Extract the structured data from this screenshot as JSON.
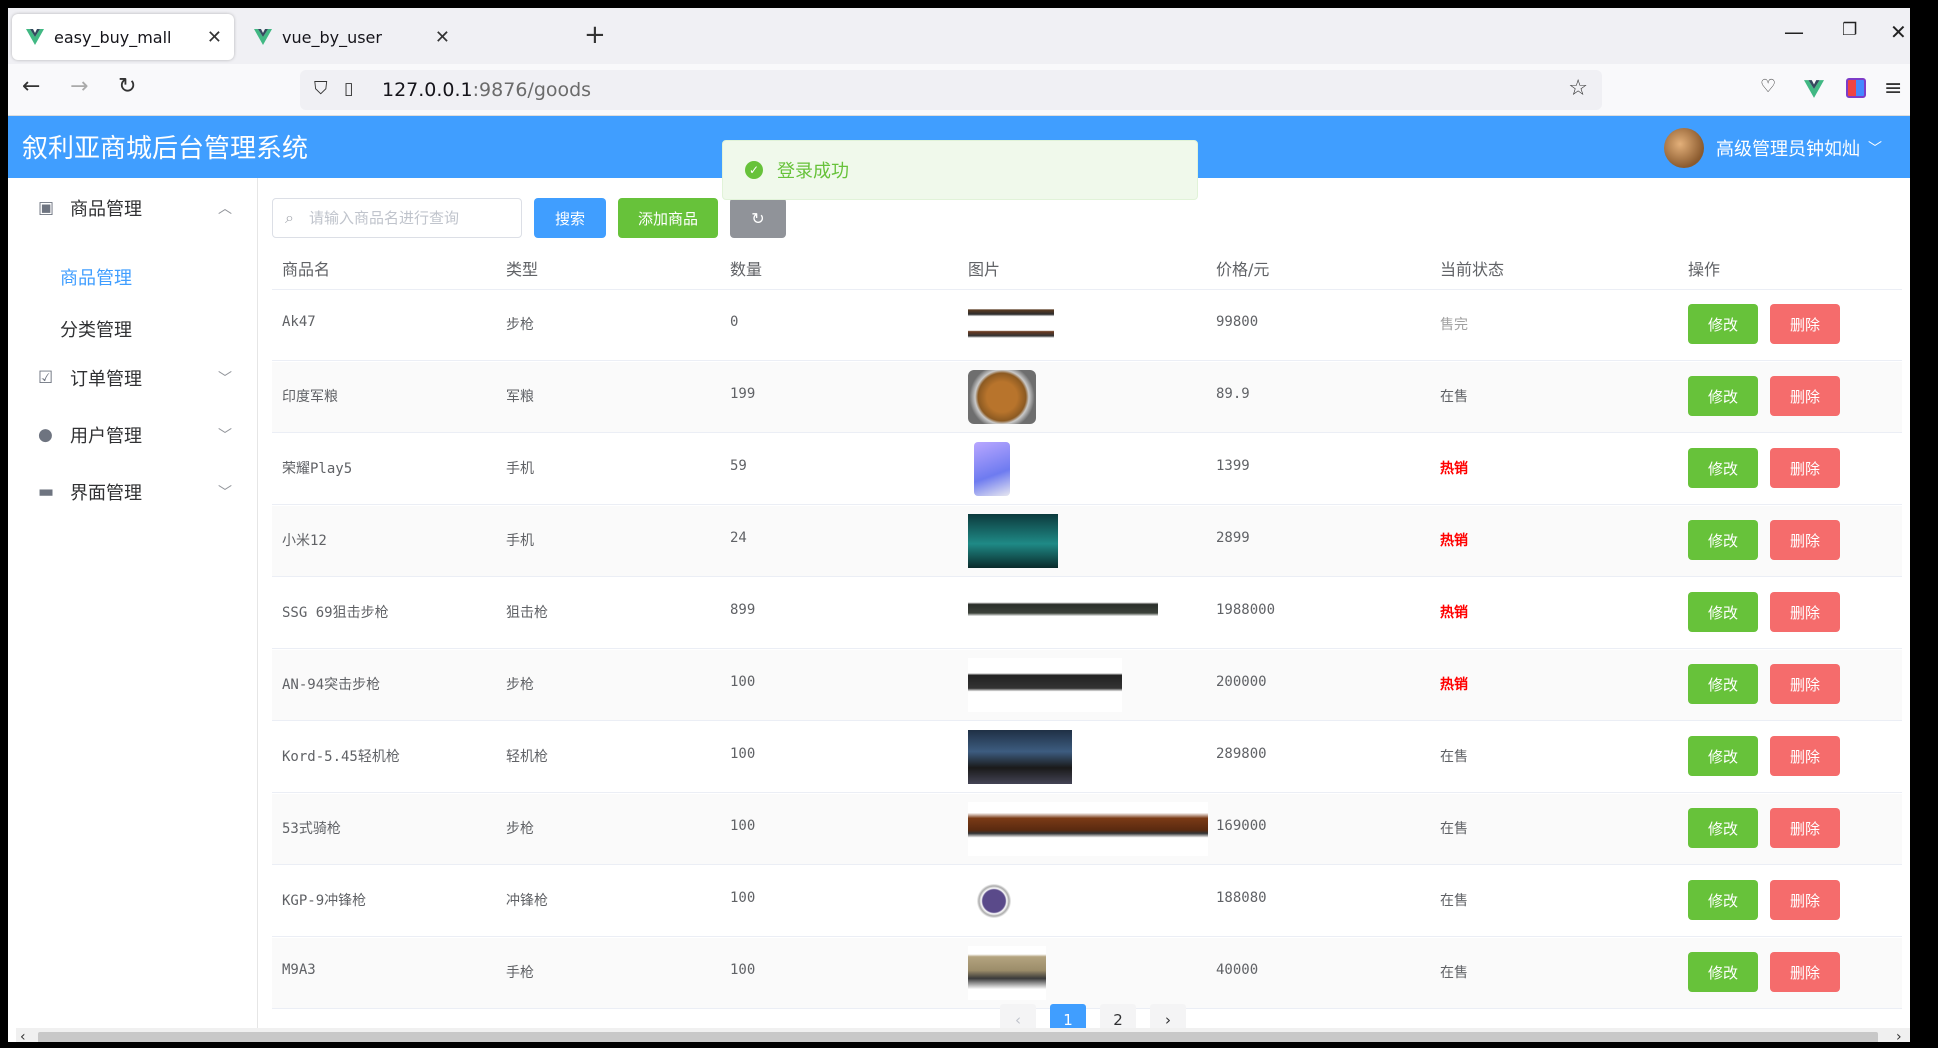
{
  "browser": {
    "tabs": [
      {
        "title": "easy_buy_mall",
        "active": true
      },
      {
        "title": "vue_by_user",
        "active": false
      }
    ],
    "url_host": "127.0.0.1",
    "url_rest": ":9876/goods"
  },
  "app": {
    "title": "叙利亚商城后台管理系统",
    "user_name": "高级管理员钟如灿"
  },
  "toast": {
    "message": "登录成功"
  },
  "sidebar": {
    "menus": [
      {
        "label": "商品管理",
        "icon": "bag-icon",
        "expanded": true
      },
      {
        "label": "订单管理",
        "icon": "clipboard-icon",
        "expanded": false
      },
      {
        "label": "用户管理",
        "icon": "user-icon",
        "expanded": false
      },
      {
        "label": "界面管理",
        "icon": "monitor-icon",
        "expanded": false
      }
    ],
    "submenus": [
      {
        "label": "商品管理",
        "active": true
      },
      {
        "label": "分类管理",
        "active": false
      }
    ]
  },
  "toolbar": {
    "search_placeholder": "请输入商品名进行查询",
    "search_label": "搜索",
    "add_label": "添加商品",
    "reset_icon": "refresh-icon"
  },
  "table": {
    "headers": [
      "商品名",
      "类型",
      "数量",
      "图片",
      "价格/元",
      "当前状态",
      "操作"
    ],
    "edit_label": "修改",
    "delete_label": "删除",
    "rows": [
      {
        "name": "Ak47",
        "type": "步枪",
        "qty": "0",
        "image": "rifle-image",
        "price": "99800",
        "status": "售完"
      },
      {
        "name": "印度军粮",
        "type": "军粮",
        "qty": "199",
        "image": "food-bowl-image",
        "price": "89.9",
        "status": "在售"
      },
      {
        "name": "荣耀Play5",
        "type": "手机",
        "qty": "59",
        "image": "phone-image",
        "price": "1399",
        "status": "热销"
      },
      {
        "name": "小米12",
        "type": "手机",
        "qty": "24",
        "image": "phone-scene-image",
        "price": "2899",
        "status": "热销"
      },
      {
        "name": "SSG 69狙击步枪",
        "type": "狙击枪",
        "qty": "899",
        "image": "sniper-rifle-image",
        "price": "1988000",
        "status": "热销"
      },
      {
        "name": "AN-94突击步枪",
        "type": "步枪",
        "qty": "100",
        "image": "assault-rifle-image",
        "price": "200000",
        "status": "热销"
      },
      {
        "name": "Kord-5.45轻机枪",
        "type": "轻机枪",
        "qty": "100",
        "image": "machine-gun-image",
        "price": "289800",
        "status": "在售"
      },
      {
        "name": "53式骑枪",
        "type": "步枪",
        "qty": "100",
        "image": "carbine-image",
        "price": "169000",
        "status": "在售"
      },
      {
        "name": "KGP-9冲锋枪",
        "type": "冲锋枪",
        "qty": "100",
        "image": "smg-image",
        "price": "188080",
        "status": "在售"
      },
      {
        "name": "M9A3",
        "type": "手枪",
        "qty": "100",
        "image": "pistol-image",
        "price": "40000",
        "status": "在售"
      }
    ]
  },
  "pagination": {
    "pages": [
      "1",
      "2"
    ],
    "current": "1"
  },
  "colors": {
    "primary": "#409eff",
    "success": "#67c23a",
    "danger": "#f56c6c",
    "hot": "#ff0000"
  }
}
